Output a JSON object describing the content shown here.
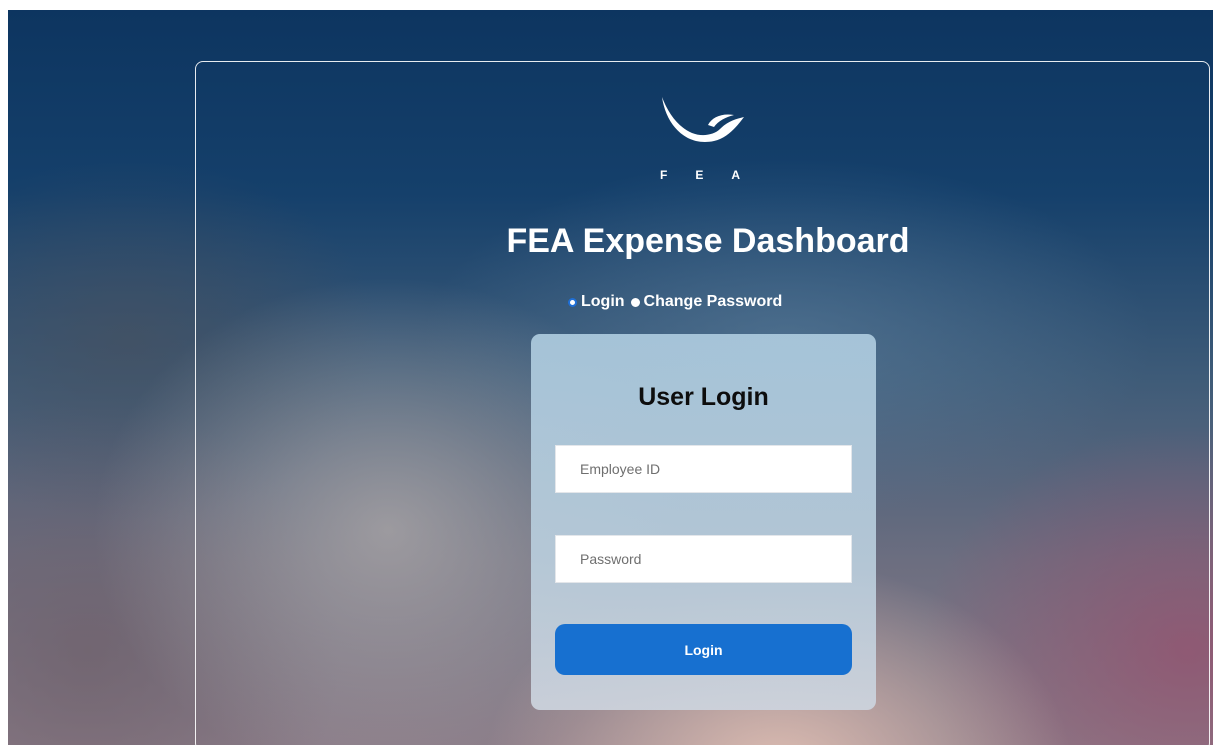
{
  "brand": {
    "logo_letters": [
      "F",
      "E",
      "A"
    ]
  },
  "header": {
    "title": "FEA Expense Dashboard"
  },
  "mode_select": {
    "options": [
      {
        "label": "Login",
        "checked": true
      },
      {
        "label": "Change Password",
        "checked": false
      }
    ]
  },
  "login_card": {
    "title": "User Login",
    "employee_id": {
      "placeholder": "Employee ID",
      "value": ""
    },
    "password": {
      "placeholder": "Password",
      "value": ""
    },
    "submit_label": "Login"
  },
  "colors": {
    "accent": "#1770d0",
    "radio_checked": "#1f6fd6",
    "text_on_dark": "#ffffff"
  },
  "icons": [
    "fea-bird-logo-icon",
    "radio-checked-icon",
    "radio-unchecked-icon"
  ]
}
